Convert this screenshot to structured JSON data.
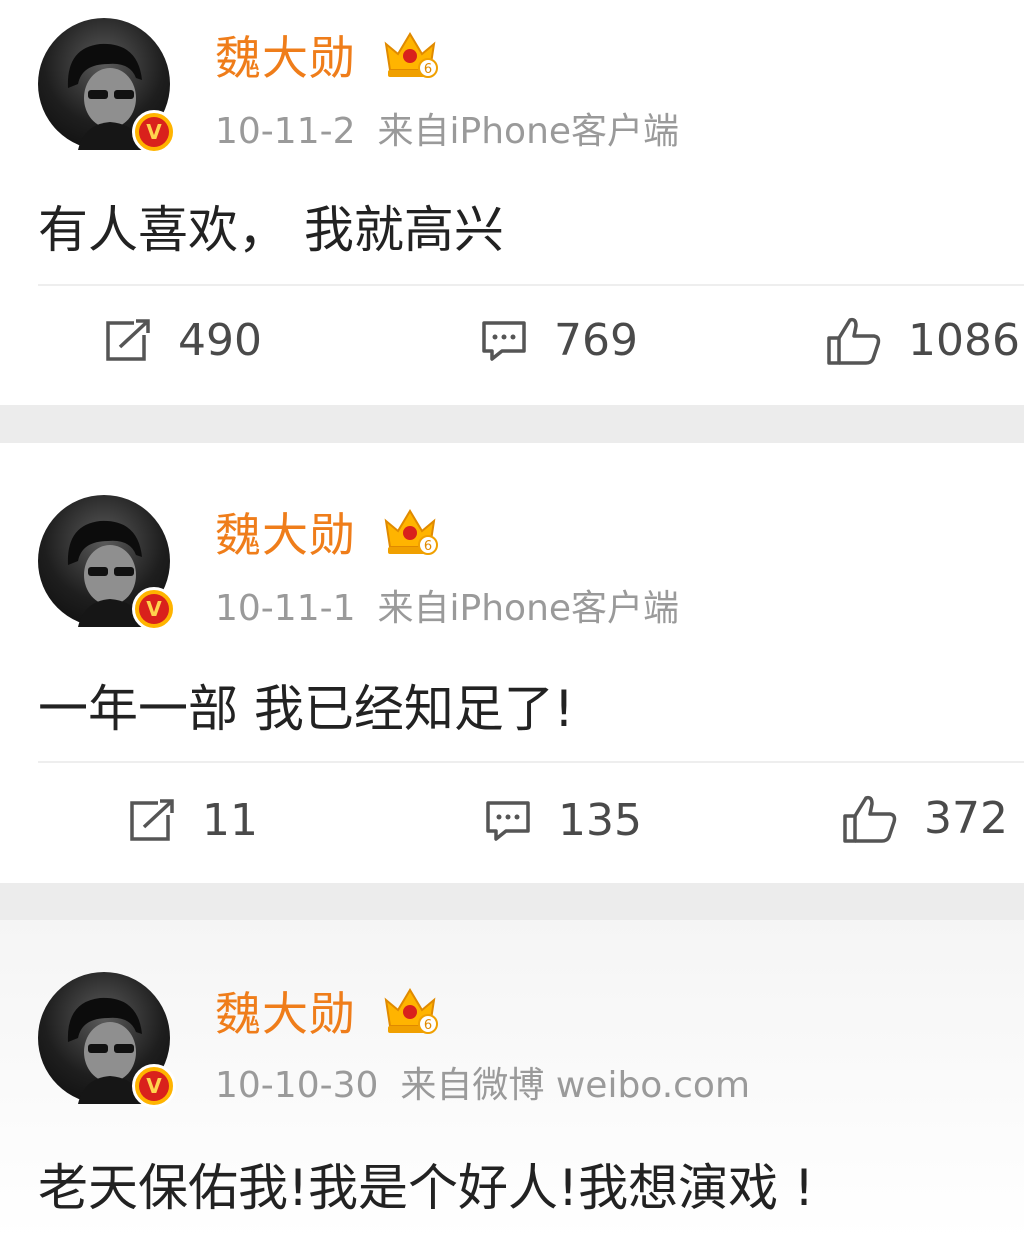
{
  "posts": [
    {
      "username": "魏大勋",
      "time": "10-11-2",
      "source": "来自iPhone客户端",
      "text": "有人喜欢， 我就高兴",
      "reposts": "490",
      "comments": "769",
      "likes": "1086"
    },
    {
      "username": "魏大勋",
      "time": "10-11-1",
      "source": "来自iPhone客户端",
      "text": "一年一部 我已经知足了!",
      "reposts": "11",
      "comments": "135",
      "likes": "372"
    },
    {
      "username": "魏大勋",
      "time": "10-10-30",
      "source": "来自微博 weibo.com",
      "text": "老天保佑我!我是个好人!我想演戏 !"
    }
  ],
  "badges": {
    "verified_letter": "V",
    "crown_level": "6"
  },
  "colors": {
    "username": "#ef7d1a",
    "meta": "#9a9a9a",
    "text": "#222222",
    "verified_badge": "#d9211c",
    "crown": "#ffb400",
    "separator": "#ececec"
  },
  "icons": {
    "repost": "repost-icon",
    "comment": "comment-icon",
    "like": "like-icon",
    "crown": "vip-crown-icon",
    "verified": "verified-v-icon"
  }
}
